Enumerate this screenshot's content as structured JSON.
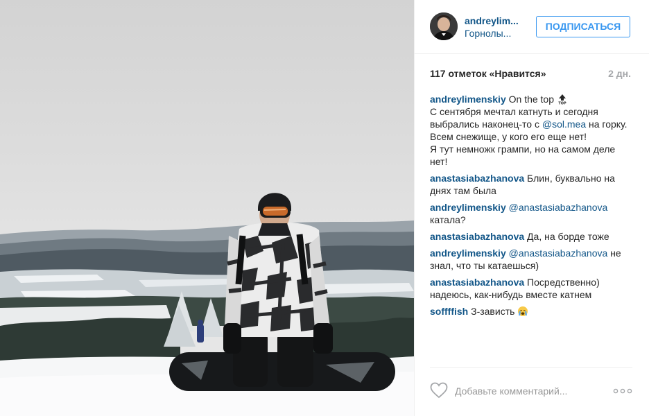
{
  "post": {
    "author": {
      "username": "andreylim...",
      "location": "Горнолы..."
    },
    "follow_label": "ПОДПИСАТЬСЯ",
    "likes": "117 отметок «Нравится»",
    "time_ago": "2 дн.",
    "comments": [
      {
        "user": "andreylimenskiy",
        "parts": [
          {
            "text": " On the top "
          },
          {
            "icon": "top-arrow-icon"
          },
          {
            "break": true
          },
          {
            "text": "С сентября мечтал катнуть и сегодня выбрались наконец-то с "
          },
          {
            "mention": "@sol.mea"
          },
          {
            "text": " на горку. Всем снежище, у кого его еще нет!"
          },
          {
            "break": true
          },
          {
            "text": "Я тут немножк грампи, но на самом деле нет!"
          }
        ]
      },
      {
        "user": "anastasiabazhanova",
        "parts": [
          {
            "text": " Блин, буквально на днях там была"
          }
        ]
      },
      {
        "user": "andreylimenskiy",
        "parts": [
          {
            "text": " "
          },
          {
            "mention": "@anastasiabazhanova"
          },
          {
            "text": " катала?"
          }
        ]
      },
      {
        "user": "anastasiabazhanova",
        "parts": [
          {
            "text": " Да, на борде тоже"
          }
        ]
      },
      {
        "user": "andreylimenskiy",
        "parts": [
          {
            "text": " "
          },
          {
            "mention": "@anastasiabazhanova"
          },
          {
            "text": " не знал, что ты катаешься)"
          }
        ]
      },
      {
        "user": "anastasiabazhanova",
        "parts": [
          {
            "text": " Посредственно) надеюсь, как-нибудь вместе катнем"
          }
        ]
      },
      {
        "user": "soffffish",
        "parts": [
          {
            "text": " З-зависть "
          },
          {
            "icon": "crying-emoji-icon"
          }
        ]
      }
    ],
    "comment_placeholder": "Добавьте комментарий...",
    "icons": {
      "like": "heart-icon",
      "more": "more-options-icon"
    },
    "colors": {
      "link": "#125688",
      "follow": "#3897f0",
      "muted": "#a5a7aa"
    }
  }
}
